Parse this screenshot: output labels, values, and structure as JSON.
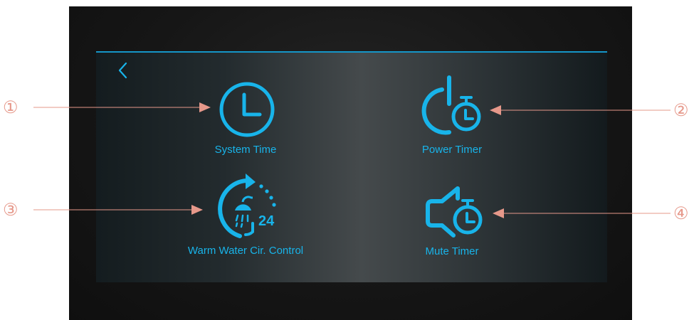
{
  "screen": {
    "accent_color": "#18b4ea",
    "back_icon": "chevron-left-icon"
  },
  "tiles": [
    {
      "label": "System Time",
      "icon": "clock-icon"
    },
    {
      "label": "Power Timer",
      "icon": "power-timer-icon"
    },
    {
      "label": "Warm Water Cir. Control",
      "icon": "warm-water-circulation-icon",
      "icon_badge": "24"
    },
    {
      "label": "Mute Timer",
      "icon": "mute-timer-icon"
    }
  ],
  "callouts": [
    "①",
    "②",
    "③",
    "④"
  ],
  "callout_color": "#e6988a"
}
